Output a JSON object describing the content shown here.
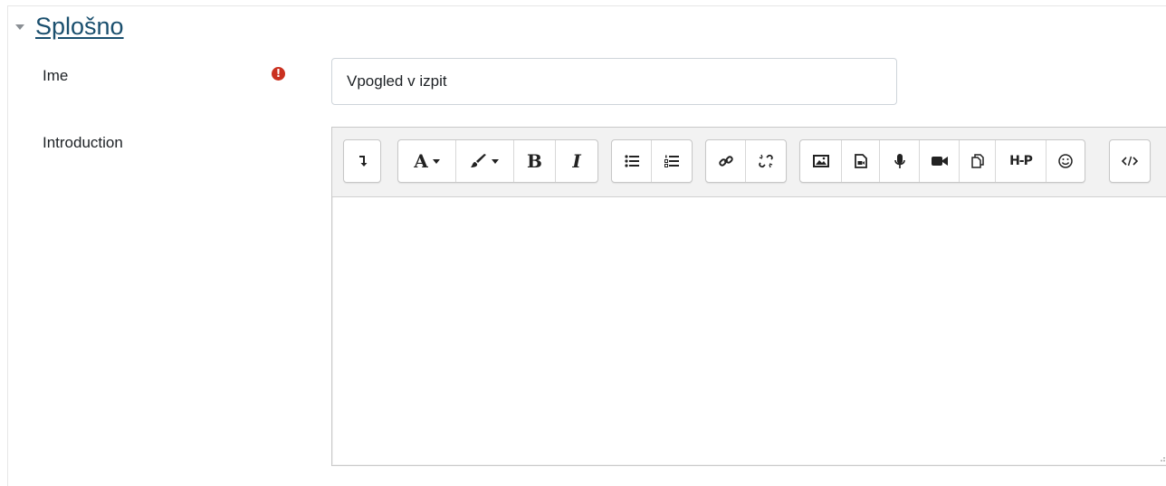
{
  "section": {
    "title": "Splošno"
  },
  "fields": {
    "name": {
      "label": "Ime",
      "value": "Vpogled v izpit"
    },
    "intro": {
      "label": "Introduction"
    }
  },
  "toolbar": {
    "items": [
      "show-more-buttons",
      "font-color",
      "highlight-color",
      "bold",
      "italic",
      "unordered-list",
      "ordered-list",
      "link",
      "unlink",
      "image",
      "media",
      "record-audio",
      "record-video",
      "manage-files",
      "h5p",
      "emoticon",
      "html-source"
    ],
    "bold_label": "B",
    "italic_label": "I",
    "font_label": "A",
    "h5p_label": "H-P"
  },
  "colors": {
    "accent": "#1a4f6e",
    "required": "#ca3120"
  }
}
